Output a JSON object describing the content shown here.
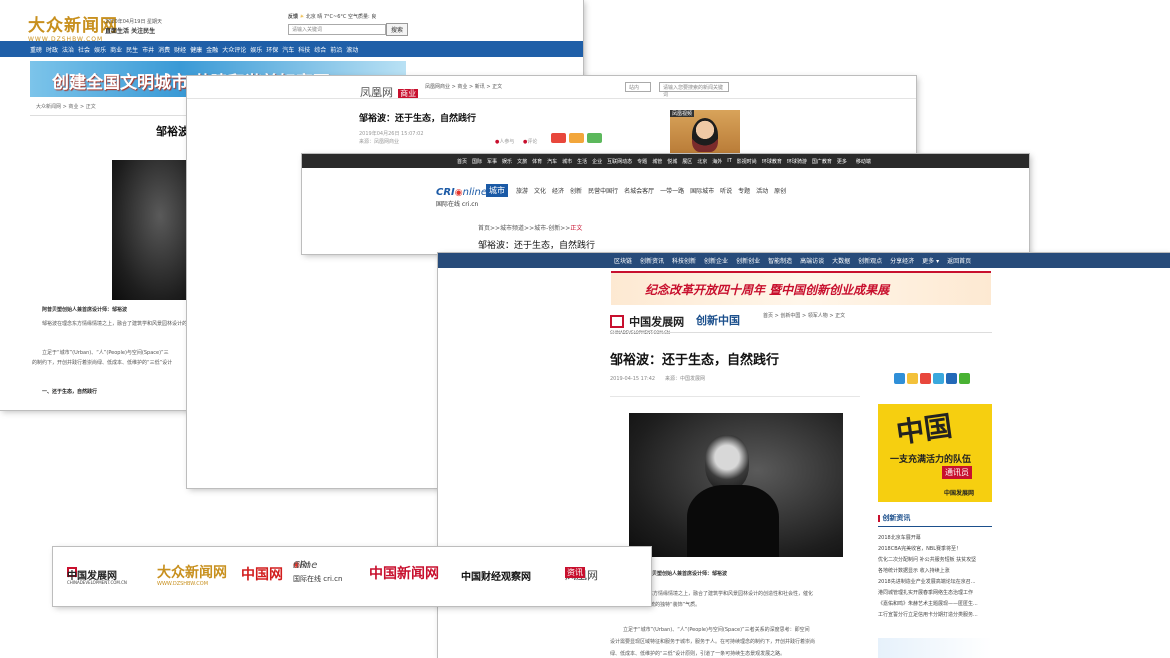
{
  "dazhong": {
    "logo": "大众新闻网",
    "logo_url": "WWW.DZSHBW.COM",
    "date": "2020年04月19日 星期天",
    "slogan": "直面生活 关注民生",
    "weather": "北京 晴 7°C~6°C 空气质量: 良",
    "weather_label": "反馈",
    "search_placeholder": "请输入关键词",
    "search_button": "搜索",
    "nav": [
      "重磅",
      "时政",
      "法治",
      "社会",
      "娱乐",
      "商业",
      "民生",
      "市井",
      "消费",
      "财经",
      "健康",
      "金融",
      "大众评论",
      "娱乐",
      "环保",
      "汽车",
      "科技",
      "综合",
      "前沿",
      "滚动"
    ],
    "banner": "创建全国文明城市  共建和谐美好家园",
    "breadcrumb": "大众新闻网 > 商业 > 正文",
    "title_partial": "邹裕波",
    "caption": "阿普贝塑创始人兼首席设计师：邹裕波",
    "p1": "邹裕波在理念东方情缘情境之上，融合了建筑学和风景园林设计的",
    "p2": "立足于“城市”(Urban)、“人”(People)与空间(Space)”三",
    "p3": "的制约下，开创并践行着崇尚绿、低成本、低维护的“三低”设计",
    "heading": "一、还于生态，自然践行"
  },
  "ifeng": {
    "logo": "凤凰网",
    "logo_tag": "商业",
    "breadcrumb": "凤凰网商业 > 商业 > 新讯 > 正文",
    "search_select": "站内",
    "search_placeholder": "请输入您要搜索的新闻关键词",
    "title": "邹裕波：还于生态，自然践行",
    "date": "2019年04月26日 15:07:02",
    "source": "来源：凤凰网商业",
    "stat1": "人参与",
    "stat2": "评论",
    "ad_label": "凤凰视频"
  },
  "cri": {
    "topnav": [
      "首页",
      "国际",
      "军事",
      "娱乐",
      "文旅",
      "体育",
      "汽车",
      "城市",
      "生活",
      "企业",
      "互联网动态",
      "专题",
      "城管",
      "悦城",
      "展区",
      "北京",
      "海外",
      "IT",
      "影视时尚",
      "环球教育",
      "环球骑游",
      "国广教育",
      "更多"
    ],
    "topnav_right": "移动端",
    "logo": "CRI",
    "logo_suffix": "nline",
    "logo_cn": "国际在线 cri.cn",
    "logo_tag": "城市",
    "nav": [
      "旅游",
      "文化",
      "经济",
      "创新",
      "民营中国行",
      "名城会客厅",
      "一带一路",
      "国际城市",
      "听说",
      "专题",
      "活动",
      "原创"
    ],
    "breadcrumb_prefix": "首页>>城市频道>>城市-创新>>",
    "breadcrumb_last": "正文",
    "title": "邹裕波：还于生态，自然践行"
  },
  "cd": {
    "topnav": [
      "区块链",
      "创新资讯",
      "科技创新",
      "创新企业",
      "创新创业",
      "智能制造",
      "高端访谈",
      "大数据",
      "创新观点",
      "分享经济",
      "更多 ▾",
      "返回首页"
    ],
    "banner": "纪念改革开放四十周年  暨中国创新创业成果展",
    "logo_cn": "中国发展网",
    "logo_en": "CHINADEVELOPMENT.COM.CN",
    "logo_channel": "创新中国",
    "breadcrumb": "首页 > 创新中国 > 领军人物 > 正文",
    "title": "邹裕波：还于生态，自然践行",
    "date": "2019-04-15 17:42",
    "source": "来源：中国发展网",
    "caption": "阿普贝塑创始人兼首席设计师：邹裕波",
    "p1": "裕波在理念东方情缘情境之上，融合了建筑学和风景园林设计的创造性和社会性，催化",
    "p2": "了他拥有一种反传统的独特“装饰”气质。",
    "p3": "立足于“城市”(Urban)、“人”(People)与空间(Space)”三者关系的深度思考：即空间",
    "p4": "设计需要显现区域特征和服务于城市，服务于人。在可持续理念的制约下，开创并践行着崇尚",
    "p5": "绿、低成本、低维护的“三低”设计原则，引道了一条可持续生态景观发展之路。",
    "ad_slogan": "一支充满活力的队伍",
    "ad_big": "中国",
    "ad_badge": "通讯员",
    "sidebar_heading": "创新资讯",
    "news": [
      "2018北京车展开幕",
      "2018CBA完美收官，NBL赛季将至！",
      "优化二次分配制问 补公共服务短板 扶贫攻坚",
      "各地统计数据显示 收入持续上涨",
      "2018先进制造业产业发展高端论坛在京召...",
      "港同城管理扎实开展春季网络生态治理工作",
      "《嘉佑和鸣》朱赫艺术主题展现——匿匿生...",
      "工行宣誓分行立足信用卡分期打造分类服务..."
    ]
  },
  "logos": [
    "中国发展网",
    "CHINADEVELOPMENT.COM.CN",
    "大众新闻网",
    "WWW.DZSHBW.COM",
    "中国网",
    "CRI",
    "nline",
    "国际在线 cri.cn",
    "中国新闻网",
    "中国财经观察网",
    "凤凰网",
    "资讯"
  ]
}
